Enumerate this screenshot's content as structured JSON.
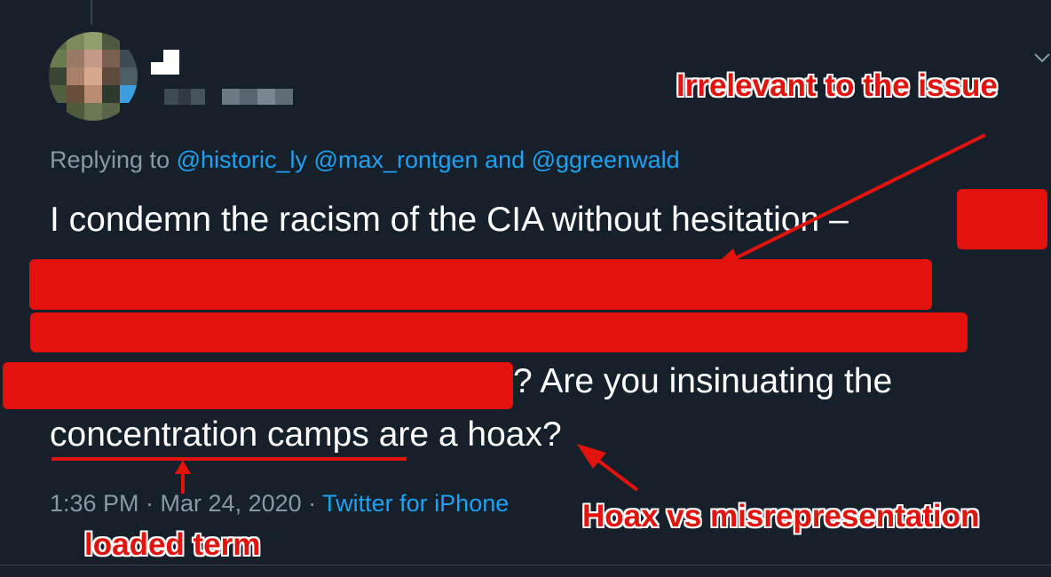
{
  "reply": {
    "prefix": "Replying to",
    "mentions": "@historic_ly @max_rontgen and @ggreenwald"
  },
  "tweet": {
    "line1": "I condemn the racism of the CIA without hesitation –",
    "line4": "? Are you insinuating the",
    "line5": "concentration camps are a hoax?"
  },
  "meta": {
    "time": "1:36 PM · Mar 24, 2020 ·",
    "client": "Twitter for iPhone"
  },
  "annotations": {
    "top": "Irrelevant to the issue",
    "hoax": "Hoax vs misrepresentation",
    "loaded": "loaded term"
  },
  "colors": {
    "background": "#15202b",
    "annotation_red": "#e2130d",
    "link_blue": "#1da1f2",
    "muted": "#8899a6"
  },
  "icons": [
    "chevron-down-icon"
  ]
}
